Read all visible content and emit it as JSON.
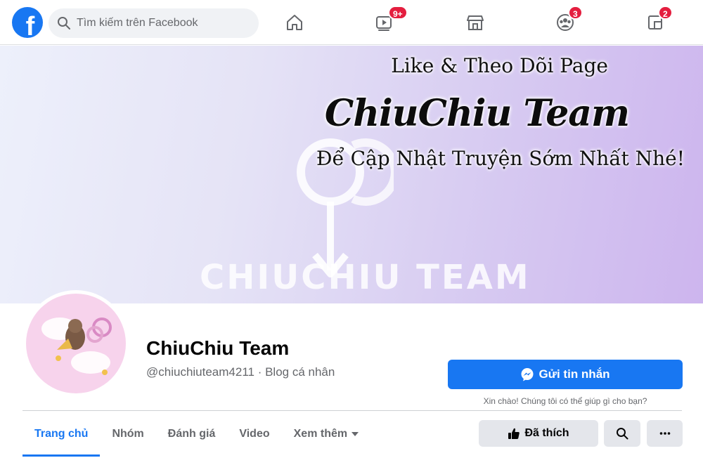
{
  "topbar": {
    "logo_letter": "f",
    "search_placeholder": "Tìm kiếm trên Facebook",
    "nav": [
      {
        "name": "home",
        "icon": "home-icon",
        "badge": ""
      },
      {
        "name": "watch",
        "icon": "video-icon",
        "badge": "9+"
      },
      {
        "name": "marketplace",
        "icon": "marketplace-icon",
        "badge": ""
      },
      {
        "name": "groups",
        "icon": "groups-icon",
        "badge": "3"
      },
      {
        "name": "gaming",
        "icon": "gaming-icon",
        "badge": "2"
      }
    ]
  },
  "cover": {
    "line1": "Like & Theo Dõi Page",
    "line2": "ChiuChiu Team",
    "line3": "Để Cập Nhật Truyện Sớm Nhất Nhé!",
    "watermark": "CHIUCHIU TEAM"
  },
  "profile": {
    "name": "ChiuChiu Team",
    "subtitle": "@chiuchiuteam4211 · Blog cá nhân",
    "message_button": "Gửi tin nhắn",
    "message_hint": "Xin chào! Chúng tôi có thể giúp gì cho bạn?"
  },
  "tabs": [
    {
      "label": "Trang chủ",
      "active": true
    },
    {
      "label": "Nhóm",
      "active": false
    },
    {
      "label": "Đánh giá",
      "active": false
    },
    {
      "label": "Video",
      "active": false
    },
    {
      "label": "Xem thêm",
      "active": false
    }
  ],
  "actions": {
    "liked_label": "Đã thích"
  },
  "colors": {
    "brand": "#1877f2",
    "badge": "#e41e3f",
    "secondary_button": "#e4e6eb"
  }
}
